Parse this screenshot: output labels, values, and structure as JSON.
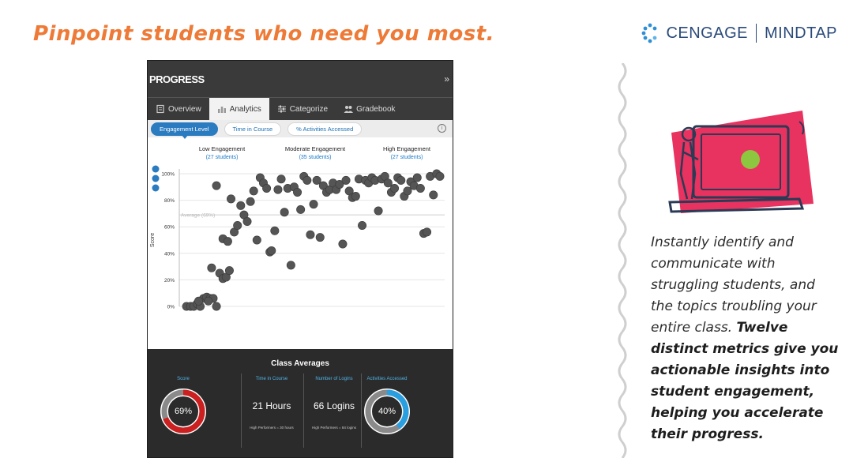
{
  "title": "Pinpoint students who need you most.",
  "brand": {
    "left": "CENGAGE",
    "right": "MINDTAP"
  },
  "panel": {
    "title": "PROGRESS",
    "collapse": "»",
    "tabs": [
      {
        "label": "Overview",
        "icon": "document-icon"
      },
      {
        "label": "Analytics",
        "icon": "bar-chart-icon"
      },
      {
        "label": "Categorize",
        "icon": "sliders-icon"
      },
      {
        "label": "Gradebook",
        "icon": "people-icon"
      }
    ],
    "metric_pills": [
      "Engagement Level",
      "Time in Course",
      "% Activities Accessed"
    ],
    "info": "i"
  },
  "chart_data": {
    "type": "scatter",
    "ylabel": "Score",
    "ylim": [
      0,
      100
    ],
    "y_ticks": [
      "0%",
      "20%",
      "40%",
      "60%",
      "80%",
      "100%"
    ],
    "average_label": "Average (69%)",
    "average_value": 69,
    "groups": [
      {
        "label": "Low Engagement",
        "sub": "(27 students)"
      },
      {
        "label": "Moderate Engagement",
        "sub": "(35 students)"
      },
      {
        "label": "High Engagement",
        "sub": "(27 students)"
      }
    ],
    "points": [
      [
        0.5,
        0
      ],
      [
        1.0,
        0
      ],
      [
        1.4,
        0
      ],
      [
        1.8,
        2
      ],
      [
        2.2,
        0
      ],
      [
        2.6,
        6
      ],
      [
        3.0,
        7
      ],
      [
        3.4,
        6
      ],
      [
        3.8,
        6
      ],
      [
        4.2,
        0
      ],
      [
        2.0,
        4
      ],
      [
        3.2,
        4
      ],
      [
        3.6,
        29
      ],
      [
        4.6,
        25
      ],
      [
        5.0,
        21
      ],
      [
        5.4,
        22
      ],
      [
        5.8,
        27
      ],
      [
        4.2,
        91
      ],
      [
        5.0,
        51
      ],
      [
        5.6,
        49
      ],
      [
        6.0,
        81
      ],
      [
        6.4,
        56
      ],
      [
        6.8,
        61
      ],
      [
        7.2,
        76
      ],
      [
        7.6,
        69
      ],
      [
        8.0,
        64
      ],
      [
        8.4,
        79
      ],
      [
        8.8,
        87
      ],
      [
        9.2,
        50
      ],
      [
        9.6,
        97
      ],
      [
        10.0,
        93
      ],
      [
        10.4,
        89
      ],
      [
        10.8,
        41
      ],
      [
        11.0,
        42
      ],
      [
        11.4,
        57
      ],
      [
        11.8,
        88
      ],
      [
        12.2,
        96
      ],
      [
        12.6,
        71
      ],
      [
        13.0,
        89
      ],
      [
        13.4,
        31
      ],
      [
        13.8,
        90
      ],
      [
        14.2,
        86
      ],
      [
        14.6,
        73
      ],
      [
        15.0,
        98
      ],
      [
        15.4,
        95
      ],
      [
        15.8,
        54
      ],
      [
        16.2,
        77
      ],
      [
        16.6,
        95
      ],
      [
        17.0,
        52
      ],
      [
        17.4,
        91
      ],
      [
        17.8,
        86
      ],
      [
        18.2,
        88
      ],
      [
        18.6,
        93
      ],
      [
        19.0,
        88
      ],
      [
        19.4,
        92
      ],
      [
        19.8,
        47
      ],
      [
        20.2,
        95
      ],
      [
        20.6,
        87
      ],
      [
        21.0,
        82
      ],
      [
        21.4,
        83
      ],
      [
        21.8,
        96
      ],
      [
        22.2,
        61
      ],
      [
        22.6,
        95
      ],
      [
        23.0,
        93
      ],
      [
        23.4,
        97
      ],
      [
        23.8,
        95
      ],
      [
        24.2,
        72
      ],
      [
        24.6,
        96
      ],
      [
        25.0,
        98
      ],
      [
        25.4,
        93
      ],
      [
        25.8,
        86
      ],
      [
        26.2,
        89
      ],
      [
        26.6,
        97
      ],
      [
        27.0,
        95
      ],
      [
        27.4,
        83
      ],
      [
        27.8,
        87
      ],
      [
        28.2,
        94
      ],
      [
        28.6,
        91
      ],
      [
        29.0,
        97
      ],
      [
        29.4,
        89
      ],
      [
        29.8,
        55
      ],
      [
        30.2,
        56
      ],
      [
        30.6,
        98
      ],
      [
        31.0,
        84
      ],
      [
        31.4,
        100
      ],
      [
        31.8,
        98
      ]
    ],
    "x_max": 32
  },
  "averages": {
    "title": "Class Averages",
    "metrics": [
      {
        "label": "Score",
        "value": "69%",
        "percent": 69,
        "color": "#cc1f1f",
        "footer": ""
      },
      {
        "label": "Time in Course",
        "value": "21 Hours",
        "footer": "High Performers = 30 hours"
      },
      {
        "label": "Number of Logins",
        "value": "66 Logins",
        "footer": "High Performers = 84 logins"
      },
      {
        "label": "Activities Accessed",
        "value": "40%",
        "percent": 40,
        "color": "#2a9fe0",
        "footer": ""
      }
    ]
  },
  "description": {
    "normal": "Instantly identify and communicate with struggling students, and the topics troubling your entire class.",
    "bold": "Twelve distinct metrics give you actionable insights into student engagement, helping you accelerate their progress."
  },
  "colors": {
    "title": "#ee7a37",
    "brand": "#2a4a7a",
    "accent_pink": "#e8325f",
    "accent_green": "#8dc63f"
  }
}
